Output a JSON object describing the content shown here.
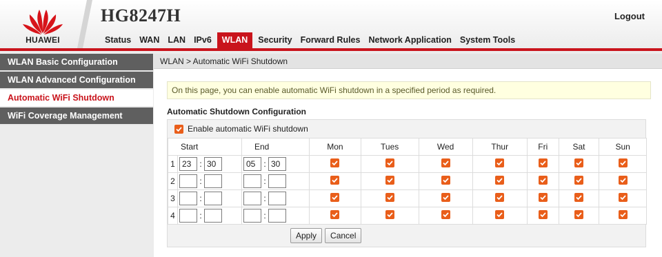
{
  "brand": {
    "name": "HUAWEI",
    "model": "HG8247H",
    "logo_icon": "huawei-petal-logo-icon",
    "accent": "#c9141c"
  },
  "header": {
    "logout_label": "Logout"
  },
  "nav": {
    "items": [
      {
        "label": "Status"
      },
      {
        "label": "WAN"
      },
      {
        "label": "LAN"
      },
      {
        "label": "IPv6"
      },
      {
        "label": "WLAN",
        "active": true
      },
      {
        "label": "Security"
      },
      {
        "label": "Forward Rules"
      },
      {
        "label": "Network Application"
      },
      {
        "label": "System Tools"
      }
    ]
  },
  "sidebar": {
    "items": [
      {
        "label": "WLAN Basic Configuration"
      },
      {
        "label": "WLAN Advanced Configuration"
      },
      {
        "label": "Automatic WiFi Shutdown",
        "active": true
      },
      {
        "label": "WiFi Coverage Management"
      }
    ]
  },
  "breadcrumb": "WLAN > Automatic WiFi Shutdown",
  "notice": "On this page, you can enable automatic WiFi shutdown in a specified period as required.",
  "section_title": "Automatic Shutdown Configuration",
  "enable": {
    "label": "Enable automatic WiFi shutdown",
    "checked": true,
    "checkbox_color": "#e95e1a"
  },
  "table": {
    "headers": {
      "start": "Start",
      "end": "End",
      "days": [
        "Mon",
        "Tues",
        "Wed",
        "Thur",
        "Fri",
        "Sat",
        "Sun"
      ]
    },
    "colon": ":",
    "rows": [
      {
        "num": "1",
        "start_h": "23",
        "start_m": "30",
        "end_h": "05",
        "end_m": "30",
        "days": [
          true,
          true,
          true,
          true,
          true,
          true,
          true
        ]
      },
      {
        "num": "2",
        "start_h": "",
        "start_m": "",
        "end_h": "",
        "end_m": "",
        "days": [
          true,
          true,
          true,
          true,
          true,
          true,
          true
        ]
      },
      {
        "num": "3",
        "start_h": "",
        "start_m": "",
        "end_h": "",
        "end_m": "",
        "days": [
          true,
          true,
          true,
          true,
          true,
          true,
          true
        ]
      },
      {
        "num": "4",
        "start_h": "",
        "start_m": "",
        "end_h": "",
        "end_m": "",
        "days": [
          true,
          true,
          true,
          true,
          true,
          true,
          true
        ]
      }
    ]
  },
  "buttons": {
    "apply": "Apply",
    "cancel": "Cancel"
  }
}
